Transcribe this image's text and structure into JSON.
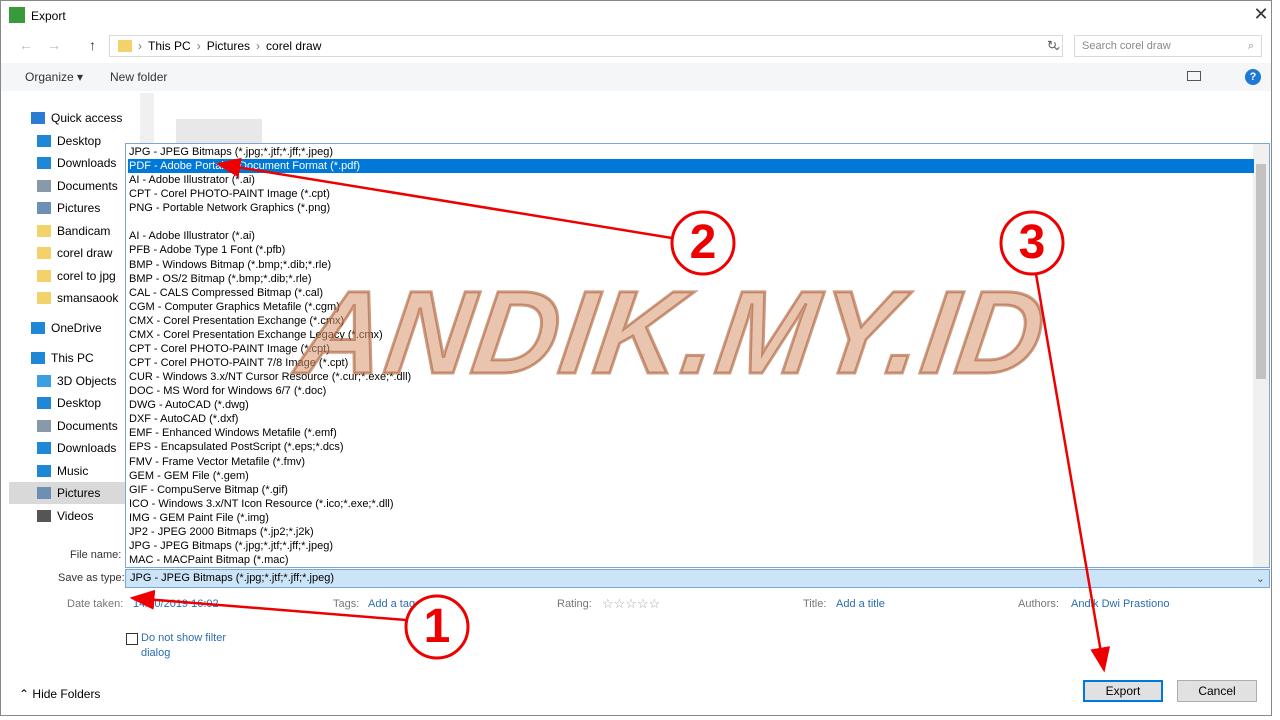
{
  "window": {
    "title": "Export"
  },
  "address": {
    "path": [
      "This PC",
      "Pictures",
      "corel draw"
    ],
    "search_placeholder": "Search corel draw"
  },
  "toolbar": {
    "organize": "Organize ▾",
    "new_folder": "New folder"
  },
  "sidebar": {
    "items": [
      {
        "label": "Quick access",
        "icon": "star-icon",
        "color": "#2b7cd3"
      },
      {
        "label": "Desktop",
        "icon": "desktop-icon",
        "color": "#1e88d6"
      },
      {
        "label": "Downloads",
        "icon": "download-icon",
        "color": "#1e88d6"
      },
      {
        "label": "Documents",
        "icon": "documents-icon",
        "color": "#8899aa"
      },
      {
        "label": "Pictures",
        "icon": "pictures-icon",
        "color": "#6d8fb3"
      },
      {
        "label": "Bandicam",
        "icon": "folder-icon",
        "color": "#f3d16b"
      },
      {
        "label": "corel draw",
        "icon": "folder-icon",
        "color": "#f3d16b"
      },
      {
        "label": "corel to jpg",
        "icon": "folder-icon",
        "color": "#f3d16b"
      },
      {
        "label": "smansaook",
        "icon": "folder-icon",
        "color": "#f3d16b"
      },
      {
        "label": "OneDrive",
        "icon": "cloud-icon",
        "color": "#1e88d6"
      },
      {
        "label": "This PC",
        "icon": "computer-icon",
        "color": "#1e88d6"
      },
      {
        "label": "3D Objects",
        "icon": "cube-icon",
        "color": "#3aa0e0"
      },
      {
        "label": "Desktop",
        "icon": "desktop-icon",
        "color": "#1e88d6"
      },
      {
        "label": "Documents",
        "icon": "documents-icon",
        "color": "#8899aa"
      },
      {
        "label": "Downloads",
        "icon": "download-icon",
        "color": "#1e88d6"
      },
      {
        "label": "Music",
        "icon": "music-icon",
        "color": "#1e88d6"
      },
      {
        "label": "Pictures",
        "icon": "pictures-icon",
        "color": "#6d8fb3",
        "selected": true
      },
      {
        "label": "Videos",
        "icon": "videos-icon",
        "color": "#555"
      }
    ]
  },
  "filetypes": {
    "selected_index": 1,
    "options": [
      "JPG - JPEG Bitmaps (*.jpg;*.jtf;*.jff;*.jpeg)",
      "PDF - Adobe Portable Document Format (*.pdf)",
      "AI - Adobe Illustrator (*.ai)",
      "CPT - Corel PHOTO-PAINT Image (*.cpt)",
      "PNG - Portable Network Graphics (*.png)",
      "",
      "AI - Adobe Illustrator (*.ai)",
      "PFB - Adobe Type 1 Font (*.pfb)",
      "BMP - Windows Bitmap (*.bmp;*.dib;*.rle)",
      "BMP - OS/2 Bitmap (*.bmp;*.dib;*.rle)",
      "CAL - CALS Compressed Bitmap (*.cal)",
      "CGM - Computer Graphics Metafile (*.cgm)",
      "CMX - Corel Presentation Exchange (*.cmx)",
      "CMX - Corel Presentation Exchange Legacy (*.cmx)",
      "CPT - Corel PHOTO-PAINT Image (*.cpt)",
      "CPT - Corel PHOTO-PAINT 7/8 Image (*.cpt)",
      "CUR - Windows 3.x/NT Cursor Resource (*.cur;*.exe;*.dll)",
      "DOC - MS Word for Windows 6/7 (*.doc)",
      "DWG - AutoCAD (*.dwg)",
      "DXF - AutoCAD (*.dxf)",
      "EMF - Enhanced Windows Metafile (*.emf)",
      "EPS - Encapsulated PostScript (*.eps;*.dcs)",
      "FMV - Frame Vector Metafile (*.fmv)",
      "GEM - GEM File (*.gem)",
      "GIF - CompuServe Bitmap (*.gif)",
      "ICO - Windows 3.x/NT Icon Resource (*.ico;*.exe;*.dll)",
      "IMG - GEM Paint File (*.img)",
      "JP2 - JPEG 2000 Bitmaps (*.jp2;*.j2k)",
      "JPG - JPEG Bitmaps (*.jpg;*.jtf;*.jff;*.jpeg)",
      "MAC - MACPaint Bitmap (*.mac)"
    ]
  },
  "form": {
    "file_name_label": "File name:",
    "save_as_type_label": "Save as type:",
    "save_as_type_value": "JPG - JPEG Bitmaps (*.jpg;*.jtf;*.jff;*.jpeg)"
  },
  "meta": {
    "date_label": "Date taken:",
    "date_value": "14/10/2019 16:02",
    "tags_label": "Tags:",
    "tags_value": "Add a tag",
    "rating_label": "Rating:",
    "rating_stars": "☆☆☆☆☆",
    "title_label": "Title:",
    "title_value": "Add a title",
    "authors_label": "Authors:",
    "authors_value": "Andik Dwi Prastiono"
  },
  "filter_checkbox": {
    "label": "Do not show filter dialog",
    "checked": false
  },
  "footer": {
    "hide_folders": "Hide Folders",
    "export": "Export",
    "cancel": "Cancel"
  },
  "watermark": "ANDIK.MY.ID",
  "annotations": {
    "steps": [
      "1",
      "2",
      "3"
    ],
    "color": "#e00000"
  }
}
